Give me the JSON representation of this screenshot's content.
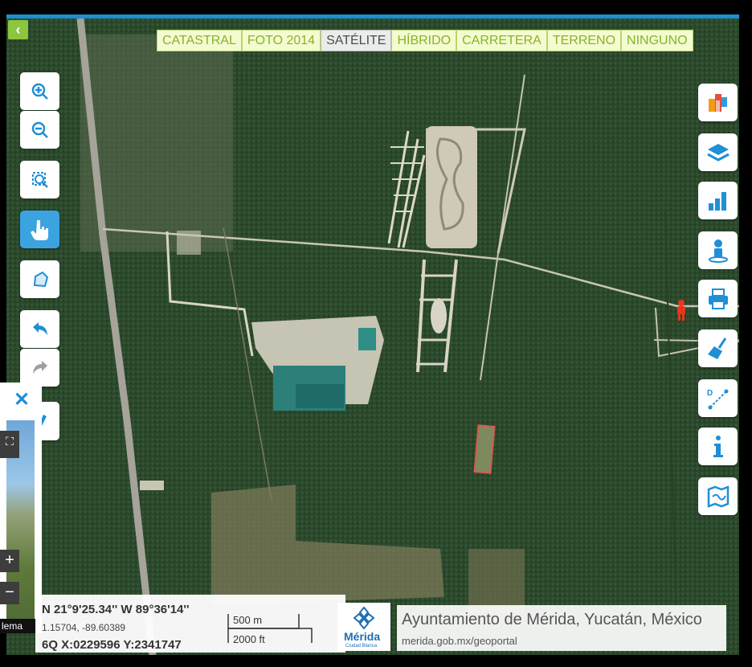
{
  "base_layers": {
    "tabs": [
      {
        "label": "CATASTRAL",
        "active": false
      },
      {
        "label": "FOTO 2014",
        "active": false
      },
      {
        "label": "SATÉLITE",
        "active": true
      },
      {
        "label": "HÍBRIDO",
        "active": false
      },
      {
        "label": "CARRETERA",
        "active": false
      },
      {
        "label": "TERRENO",
        "active": false
      },
      {
        "label": "NINGUNO",
        "active": false
      }
    ]
  },
  "left_toolbar": {
    "collapse_icon": "chevron-left-icon",
    "tools": [
      {
        "name": "zoom-in",
        "icon": "zoom-in-icon"
      },
      {
        "name": "zoom-out",
        "icon": "zoom-out-icon"
      },
      {
        "name": "zoom-box",
        "icon": "zoom-box-icon"
      },
      {
        "name": "pan",
        "icon": "hand-pointer-icon",
        "active": true
      },
      {
        "name": "draw-polygon",
        "icon": "polygon-icon"
      },
      {
        "name": "undo",
        "icon": "undo-icon"
      },
      {
        "name": "redo",
        "icon": "redo-icon"
      },
      {
        "name": "dropdown",
        "icon": "chevron-down-icon"
      }
    ]
  },
  "right_toolbar": {
    "tools": [
      {
        "name": "bookmarks",
        "icon": "bookmarks-icon"
      },
      {
        "name": "layers",
        "icon": "layers-icon"
      },
      {
        "name": "statistics",
        "icon": "bar-chart-icon"
      },
      {
        "name": "street-view",
        "icon": "person-icon"
      },
      {
        "name": "print",
        "icon": "printer-icon"
      },
      {
        "name": "clear",
        "icon": "broom-icon"
      },
      {
        "name": "measure",
        "icon": "measure-distance-icon"
      },
      {
        "name": "info",
        "icon": "info-icon"
      },
      {
        "name": "map-legend",
        "icon": "map-icon"
      }
    ]
  },
  "street_view_panel": {
    "close_icon": "close-icon",
    "zoom_in": "+",
    "zoom_out": "−",
    "label": "lema"
  },
  "coordinates": {
    "dms": "N 21°9'25.34'' W 89°36'14''",
    "decimal": "1.15704, -89.60389",
    "utm": "6Q X:0229596  Y:2341747"
  },
  "scale": {
    "metric": "500 m",
    "imperial": "2000 ft"
  },
  "logo": {
    "text": "Mérida",
    "subtext": "Ciudad Blanca"
  },
  "brand": {
    "title": "Ayuntamiento de Mérida, Yucatán, México",
    "url": "merida.gob.mx/geoportal"
  },
  "colors": {
    "accent_blue": "#1c8fd0",
    "tab_green": "#8ab22a",
    "tool_active": "#3ba3e0",
    "pegman": "#e8361c"
  }
}
